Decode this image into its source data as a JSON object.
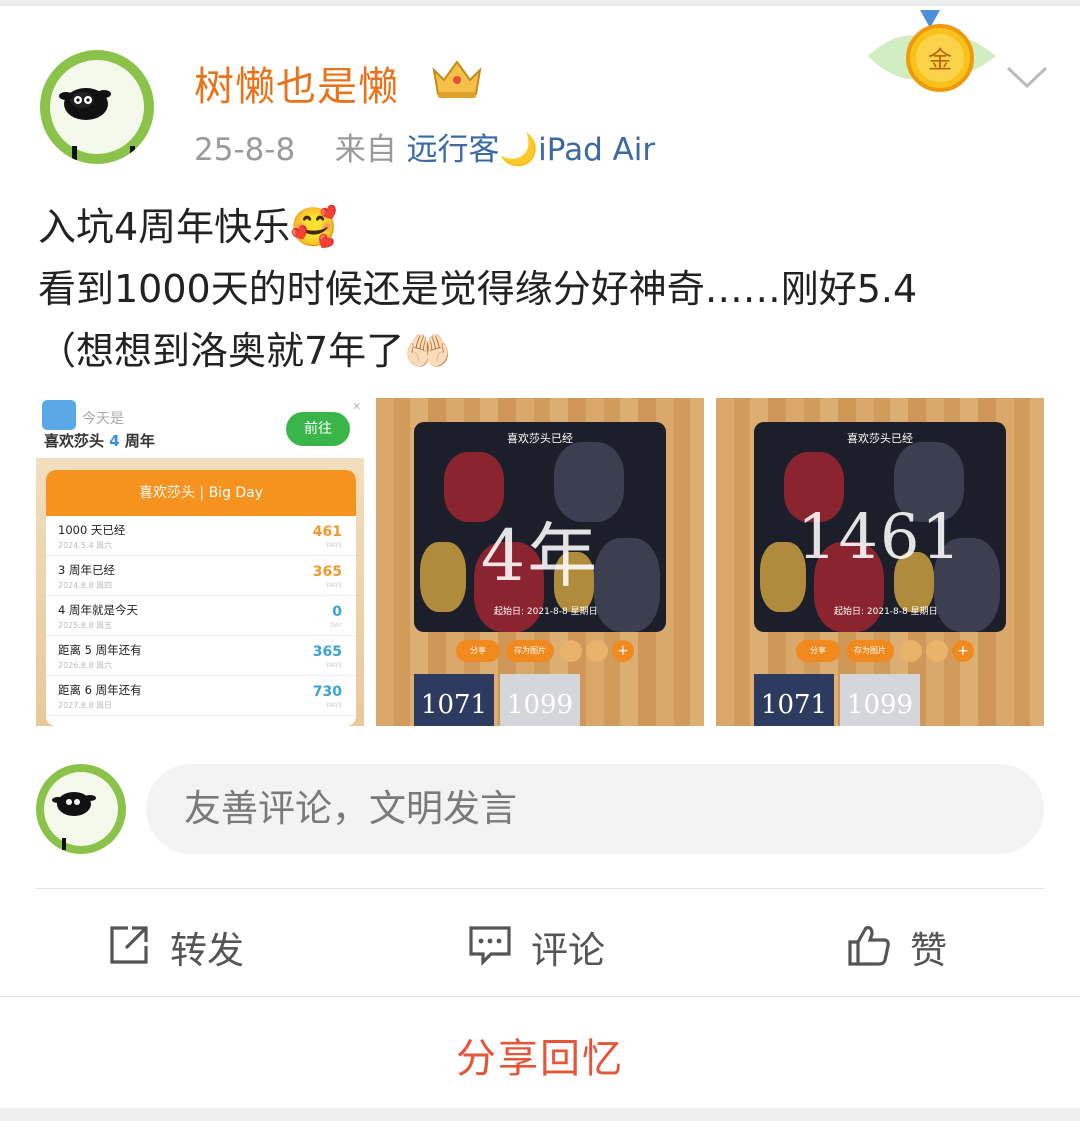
{
  "post": {
    "username": "树懒也是懒",
    "date": "25-8-8",
    "source_prefix": "来自",
    "source": "远行客🌙iPad Air",
    "text_lines": [
      "入坑4周年快乐🥰",
      "看到1000天的时候还是觉得缘分好神奇……刚好5.4",
      "（想想到洛奥就7年了🤲🏻"
    ],
    "badge_text": "金"
  },
  "images": {
    "tile1": {
      "today_label": "今天是",
      "title_pre": "喜欢莎头",
      "title_num": "4",
      "title_post": "周年",
      "goto_label": "前往",
      "card_title": "喜欢莎头 | Big Day",
      "rows": [
        {
          "label": "1000 天已经",
          "date": "2024.5.4 周六",
          "value": "461",
          "unit": "DAYS"
        },
        {
          "label": "3 周年已经",
          "date": "2024.8.8 周四",
          "value": "365",
          "unit": "DAYS"
        },
        {
          "label": "4 周年就是今天",
          "date": "2025.8.8 周五",
          "value": "0",
          "unit": "DAY"
        },
        {
          "label": "距离 5 周年还有",
          "date": "2026.8.8 周六",
          "value": "365",
          "unit": "DAYS"
        },
        {
          "label": "距离 6 周年还有",
          "date": "2027.8.8 周日",
          "value": "730",
          "unit": "DAYS"
        }
      ]
    },
    "tile2": {
      "poster_title": "喜欢莎头已经",
      "big_value": "4年",
      "since": "起始日: 2021-8-8 星期日",
      "share_btn": "分享",
      "save_btn": "存为图片",
      "thumb_a": "1071",
      "thumb_b": "1099"
    },
    "tile3": {
      "poster_title": "喜欢莎头已经",
      "big_value": "1461",
      "since": "起始日: 2021-8-8 星期日",
      "share_btn": "分享",
      "save_btn": "存为图片",
      "thumb_a": "1071",
      "thumb_b": "1099"
    }
  },
  "comment": {
    "placeholder": "友善评论，文明发言"
  },
  "actions": {
    "repost": "转发",
    "comment": "评论",
    "like": "赞"
  },
  "share_memory": "分享回忆",
  "colors": {
    "username": "#e8731a",
    "source": "#3a6aa3",
    "share": "#e6553a",
    "accent_orange": "#f6921e"
  }
}
